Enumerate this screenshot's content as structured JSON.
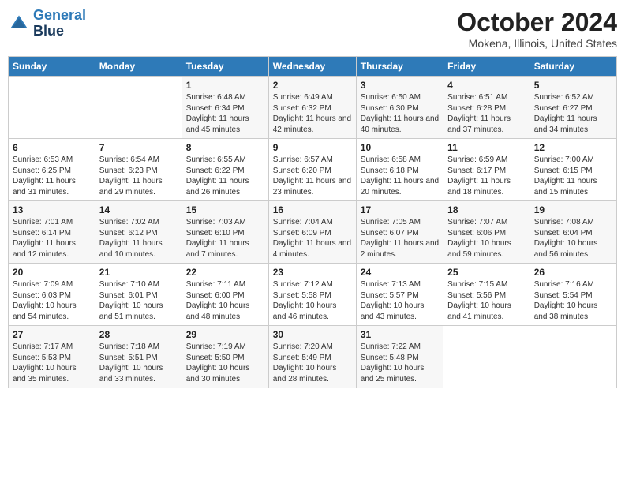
{
  "header": {
    "logo_line1": "General",
    "logo_line2": "Blue",
    "month": "October 2024",
    "location": "Mokena, Illinois, United States"
  },
  "weekdays": [
    "Sunday",
    "Monday",
    "Tuesday",
    "Wednesday",
    "Thursday",
    "Friday",
    "Saturday"
  ],
  "weeks": [
    [
      {
        "day": "",
        "sunrise": "",
        "sunset": "",
        "daylight": ""
      },
      {
        "day": "",
        "sunrise": "",
        "sunset": "",
        "daylight": ""
      },
      {
        "day": "1",
        "sunrise": "Sunrise: 6:48 AM",
        "sunset": "Sunset: 6:34 PM",
        "daylight": "Daylight: 11 hours and 45 minutes."
      },
      {
        "day": "2",
        "sunrise": "Sunrise: 6:49 AM",
        "sunset": "Sunset: 6:32 PM",
        "daylight": "Daylight: 11 hours and 42 minutes."
      },
      {
        "day": "3",
        "sunrise": "Sunrise: 6:50 AM",
        "sunset": "Sunset: 6:30 PM",
        "daylight": "Daylight: 11 hours and 40 minutes."
      },
      {
        "day": "4",
        "sunrise": "Sunrise: 6:51 AM",
        "sunset": "Sunset: 6:28 PM",
        "daylight": "Daylight: 11 hours and 37 minutes."
      },
      {
        "day": "5",
        "sunrise": "Sunrise: 6:52 AM",
        "sunset": "Sunset: 6:27 PM",
        "daylight": "Daylight: 11 hours and 34 minutes."
      }
    ],
    [
      {
        "day": "6",
        "sunrise": "Sunrise: 6:53 AM",
        "sunset": "Sunset: 6:25 PM",
        "daylight": "Daylight: 11 hours and 31 minutes."
      },
      {
        "day": "7",
        "sunrise": "Sunrise: 6:54 AM",
        "sunset": "Sunset: 6:23 PM",
        "daylight": "Daylight: 11 hours and 29 minutes."
      },
      {
        "day": "8",
        "sunrise": "Sunrise: 6:55 AM",
        "sunset": "Sunset: 6:22 PM",
        "daylight": "Daylight: 11 hours and 26 minutes."
      },
      {
        "day": "9",
        "sunrise": "Sunrise: 6:57 AM",
        "sunset": "Sunset: 6:20 PM",
        "daylight": "Daylight: 11 hours and 23 minutes."
      },
      {
        "day": "10",
        "sunrise": "Sunrise: 6:58 AM",
        "sunset": "Sunset: 6:18 PM",
        "daylight": "Daylight: 11 hours and 20 minutes."
      },
      {
        "day": "11",
        "sunrise": "Sunrise: 6:59 AM",
        "sunset": "Sunset: 6:17 PM",
        "daylight": "Daylight: 11 hours and 18 minutes."
      },
      {
        "day": "12",
        "sunrise": "Sunrise: 7:00 AM",
        "sunset": "Sunset: 6:15 PM",
        "daylight": "Daylight: 11 hours and 15 minutes."
      }
    ],
    [
      {
        "day": "13",
        "sunrise": "Sunrise: 7:01 AM",
        "sunset": "Sunset: 6:14 PM",
        "daylight": "Daylight: 11 hours and 12 minutes."
      },
      {
        "day": "14",
        "sunrise": "Sunrise: 7:02 AM",
        "sunset": "Sunset: 6:12 PM",
        "daylight": "Daylight: 11 hours and 10 minutes."
      },
      {
        "day": "15",
        "sunrise": "Sunrise: 7:03 AM",
        "sunset": "Sunset: 6:10 PM",
        "daylight": "Daylight: 11 hours and 7 minutes."
      },
      {
        "day": "16",
        "sunrise": "Sunrise: 7:04 AM",
        "sunset": "Sunset: 6:09 PM",
        "daylight": "Daylight: 11 hours and 4 minutes."
      },
      {
        "day": "17",
        "sunrise": "Sunrise: 7:05 AM",
        "sunset": "Sunset: 6:07 PM",
        "daylight": "Daylight: 11 hours and 2 minutes."
      },
      {
        "day": "18",
        "sunrise": "Sunrise: 7:07 AM",
        "sunset": "Sunset: 6:06 PM",
        "daylight": "Daylight: 10 hours and 59 minutes."
      },
      {
        "day": "19",
        "sunrise": "Sunrise: 7:08 AM",
        "sunset": "Sunset: 6:04 PM",
        "daylight": "Daylight: 10 hours and 56 minutes."
      }
    ],
    [
      {
        "day": "20",
        "sunrise": "Sunrise: 7:09 AM",
        "sunset": "Sunset: 6:03 PM",
        "daylight": "Daylight: 10 hours and 54 minutes."
      },
      {
        "day": "21",
        "sunrise": "Sunrise: 7:10 AM",
        "sunset": "Sunset: 6:01 PM",
        "daylight": "Daylight: 10 hours and 51 minutes."
      },
      {
        "day": "22",
        "sunrise": "Sunrise: 7:11 AM",
        "sunset": "Sunset: 6:00 PM",
        "daylight": "Daylight: 10 hours and 48 minutes."
      },
      {
        "day": "23",
        "sunrise": "Sunrise: 7:12 AM",
        "sunset": "Sunset: 5:58 PM",
        "daylight": "Daylight: 10 hours and 46 minutes."
      },
      {
        "day": "24",
        "sunrise": "Sunrise: 7:13 AM",
        "sunset": "Sunset: 5:57 PM",
        "daylight": "Daylight: 10 hours and 43 minutes."
      },
      {
        "day": "25",
        "sunrise": "Sunrise: 7:15 AM",
        "sunset": "Sunset: 5:56 PM",
        "daylight": "Daylight: 10 hours and 41 minutes."
      },
      {
        "day": "26",
        "sunrise": "Sunrise: 7:16 AM",
        "sunset": "Sunset: 5:54 PM",
        "daylight": "Daylight: 10 hours and 38 minutes."
      }
    ],
    [
      {
        "day": "27",
        "sunrise": "Sunrise: 7:17 AM",
        "sunset": "Sunset: 5:53 PM",
        "daylight": "Daylight: 10 hours and 35 minutes."
      },
      {
        "day": "28",
        "sunrise": "Sunrise: 7:18 AM",
        "sunset": "Sunset: 5:51 PM",
        "daylight": "Daylight: 10 hours and 33 minutes."
      },
      {
        "day": "29",
        "sunrise": "Sunrise: 7:19 AM",
        "sunset": "Sunset: 5:50 PM",
        "daylight": "Daylight: 10 hours and 30 minutes."
      },
      {
        "day": "30",
        "sunrise": "Sunrise: 7:20 AM",
        "sunset": "Sunset: 5:49 PM",
        "daylight": "Daylight: 10 hours and 28 minutes."
      },
      {
        "day": "31",
        "sunrise": "Sunrise: 7:22 AM",
        "sunset": "Sunset: 5:48 PM",
        "daylight": "Daylight: 10 hours and 25 minutes."
      },
      {
        "day": "",
        "sunrise": "",
        "sunset": "",
        "daylight": ""
      },
      {
        "day": "",
        "sunrise": "",
        "sunset": "",
        "daylight": ""
      }
    ]
  ]
}
